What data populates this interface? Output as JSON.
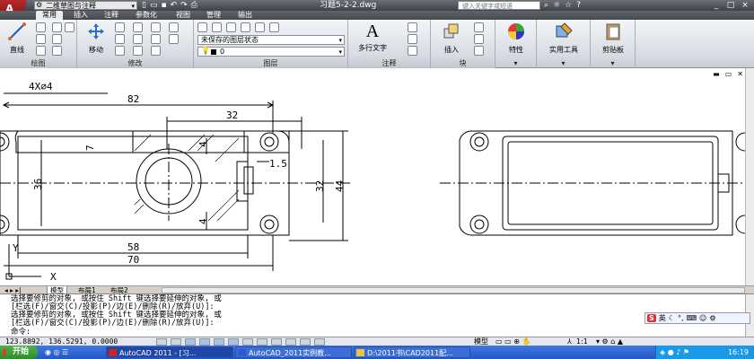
{
  "titlebar": {
    "app_logo": "A",
    "workspace": "二维草图与注释",
    "document_title": "习题5-2-2.dwg",
    "search_placeholder": "键入关键字或短语"
  },
  "ribbon_tabs": [
    "常用",
    "插入",
    "注释",
    "参数化",
    "视图",
    "管理",
    "输出"
  ],
  "ribbon": {
    "draw": {
      "line_label": "直线",
      "panel_title": "绘图"
    },
    "modify": {
      "move_label": "移动",
      "panel_title": "修改"
    },
    "layers": {
      "layer_state": "未保存的图层状态",
      "current_layer": "0",
      "panel_title": "图层"
    },
    "annotation": {
      "mtext_label": "多行文字",
      "panel_title": "注释"
    },
    "block": {
      "insert_label": "插入",
      "panel_title": "块"
    },
    "properties": {
      "label": "特性"
    },
    "utilities": {
      "label": "实用工具"
    },
    "clipboard": {
      "label": "剪贴板"
    }
  },
  "drawing": {
    "dims": {
      "hole_callout": "4X∅4",
      "overall_width": "82",
      "slot_width": "32",
      "slot_depth": "7",
      "left_height": "36",
      "detail": "1.5",
      "inner_height": "32",
      "overall_height": "44",
      "small_left": "4",
      "small_right": "4",
      "center_distance": "58",
      "base_width": "70"
    },
    "ucs_y": "Y",
    "ucs_x": "X"
  },
  "layout_tabs": [
    "模型",
    "布局1",
    "布局2"
  ],
  "command": {
    "lines": [
      "选择要修剪的对象, 或按住 Shift 键选择要延伸的对象, 或",
      "[栏选(F)/窗交(C)/投影(P)/边(E)/删除(R)/放弃(U)]:",
      "选择要修剪的对象, 或按住 Shift 键选择要延伸的对象, 或",
      "[栏选(F)/窗交(C)/投影(P)/边(E)/删除(R)/放弃(U)]:",
      "命令:"
    ]
  },
  "ime": {
    "logo": "S",
    "lang": "英"
  },
  "status": {
    "coords": "123.8892, 136.5291, 0.0000",
    "model_label": "模型",
    "scale": "1:1"
  },
  "taskbar": {
    "start": "开始",
    "tasks": [
      "AutoCAD 2011 - [习...",
      "AutoCAD_2011实例教...",
      "D:\\2011书\\CAD2011配..."
    ],
    "clock": "16:19"
  },
  "colors": {
    "ribbon_bg": "#e9ecf0",
    "taskbar": "#2556c6",
    "drawing_bg": "#ffffff"
  }
}
